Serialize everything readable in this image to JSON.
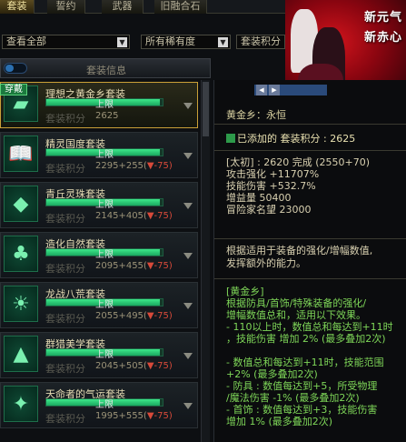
{
  "tabs": [
    {
      "label": "套装",
      "active": true
    },
    {
      "label": "誓约",
      "active": false
    },
    {
      "label": "武器",
      "active": false
    },
    {
      "label": "旧融合石",
      "active": false
    }
  ],
  "filters": {
    "type_select": "查看全部",
    "rarity_select": "所有稀有度",
    "sort_select": "套装积分"
  },
  "list_header": {
    "label": "套装信息"
  },
  "badge": "穿戴",
  "items": [
    {
      "name": "理想之黄金乡套装",
      "cap": "上限",
      "fill": 0.98,
      "score_label": "套装积分",
      "score": "2625",
      "bonus": "",
      "icon": "gold-bars-icon",
      "selected": true
    },
    {
      "name": "精灵国度套装",
      "cap": "上限",
      "fill": 0.98,
      "score_label": "套装积分",
      "score": "2295+255(",
      "bonus": "▼-75)",
      "icon": "book-icon"
    },
    {
      "name": "青丘灵珠套装",
      "cap": "上限",
      "fill": 0.98,
      "score_label": "套装积分",
      "score": "2145+405(",
      "bonus": "▼-75)",
      "icon": "fox-icon"
    },
    {
      "name": "造化自然套装",
      "cap": "上限",
      "fill": 0.98,
      "score_label": "套装积分",
      "score": "2095+455(",
      "bonus": "▼-75)",
      "icon": "tree-icon"
    },
    {
      "name": "龙战八荒套装",
      "cap": "上限",
      "fill": 0.98,
      "score_label": "套装积分",
      "score": "2055+495(",
      "bonus": "▼-75)",
      "icon": "sun-icon"
    },
    {
      "name": "群猎美学套装",
      "cap": "上限",
      "fill": 0.98,
      "score_label": "套装积分",
      "score": "2045+505(",
      "bonus": "▼-75)",
      "icon": "wolf-icon"
    },
    {
      "name": "天命者的气运套装",
      "cap": "上限",
      "fill": 0.98,
      "score_label": "套装积分",
      "score": "1995+555(",
      "bonus": "▼-75)",
      "icon": "butterfly-icon"
    }
  ],
  "detail": {
    "title": "黄金乡：永恒",
    "added_label": "已添加的 套装积分 : 2625",
    "stats": [
      "[太初] : 2620 完成 (2550+70)",
      "攻击强化 +11707%",
      "技能伤害 +532.7%",
      "增益量 50400",
      "冒险家名望 23000"
    ],
    "desc": [
      "根据适用于装备的强化/增幅数值,",
      "发挥额外的能力。"
    ],
    "green": [
      "[黄金乡]",
      "根据防具/首饰/特殊装备的强化/",
      "增幅数值总和，适用以下效果。",
      "- 110以上时，数值总和每达到+11时",
      "，技能伤害 增加 2% (最多叠加2次)",
      "",
      "- 数值总和每达到+11时，技能范围",
      "+2% (最多叠加2次)",
      "- 防具 : 数值每达到+5，所受物理",
      "/魔法伤害 -1% (最多叠加2次)",
      "- 首饰 : 数值每达到+3，技能伤害",
      "增加 1% (最多叠加2次)"
    ]
  },
  "banner": {
    "art_text_1": "新元气",
    "art_text_2": "新赤心"
  },
  "colors": {
    "accent_green": "#3ee88a",
    "gold_border": "#c9a038",
    "negative": "#d84a3a",
    "highlight_text": "#7ed658"
  }
}
